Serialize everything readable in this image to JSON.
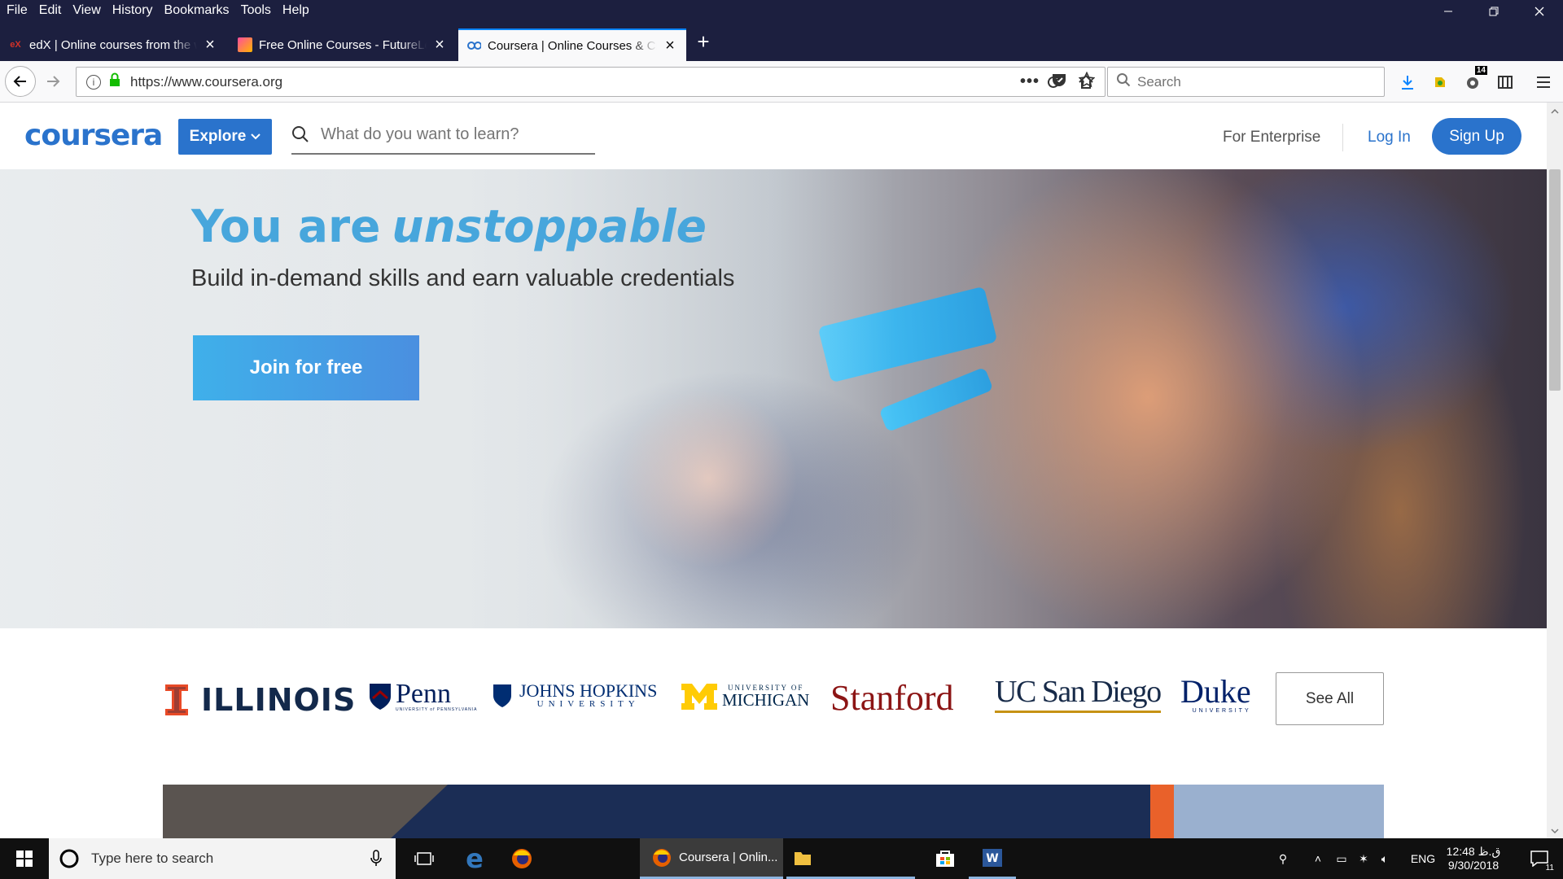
{
  "browser": {
    "menu": [
      "File",
      "Edit",
      "View",
      "History",
      "Bookmarks",
      "Tools",
      "Help"
    ],
    "tabs": [
      {
        "label": "edX | Online courses from the w",
        "favicon": "edx-icon"
      },
      {
        "label": "Free Online Courses - FutureLea",
        "favicon": "futurelearn-icon"
      },
      {
        "label": "Coursera | Online Courses & Cre",
        "favicon": "coursera-icon"
      }
    ],
    "url": "https://www.coursera.org",
    "search_placeholder": "Search",
    "badge_count": "14"
  },
  "site": {
    "logo": "coursera",
    "explore_label": "Explore",
    "search_placeholder": "What do you want to learn?",
    "enterprise_label": "For Enterprise",
    "login_label": "Log In",
    "signup_label": "Sign Up"
  },
  "hero": {
    "title_plain": "You are",
    "title_emphasis": "unstoppable",
    "subtitle": "Build in-demand skills and earn valuable credentials",
    "cta_label": "Join for free"
  },
  "partners": {
    "illinois": "ILLINOIS",
    "penn": "Penn",
    "penn_sub": "UNIVERSITY of PENNSYLVANIA",
    "jhu_main": "JOHNS HOPKINS",
    "jhu_sub": "UNIVERSITY",
    "umich_top": "UNIVERSITY OF",
    "umich_main": "MICHIGAN",
    "stanford": "Stanford",
    "ucsd": "UC San Diego",
    "duke": "Duke",
    "duke_sub": "UNIVERSITY",
    "see_all_label": "See All"
  },
  "taskbar": {
    "search_placeholder": "Type here to search",
    "active_window": "Coursera | Onlin...",
    "language": "ENG",
    "time": "12:48 ق.ظ",
    "date": "9/30/2018",
    "notification_count": "11"
  },
  "colors": {
    "brand_blue": "#2a73cc",
    "hero_title": "#47a6dc",
    "illinois_orange": "#e84a27",
    "penn_blue": "#011f5b",
    "umich_maize": "#ffcb05",
    "stanford_red": "#8c1515",
    "ucsd_navy": "#182b49",
    "duke_navy": "#012169"
  }
}
